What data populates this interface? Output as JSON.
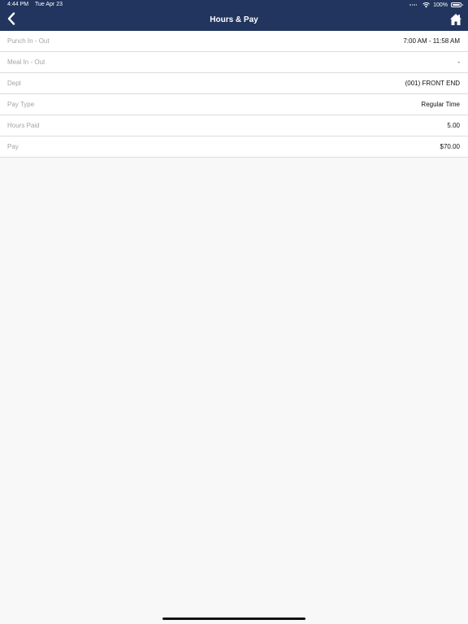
{
  "status_bar": {
    "time": "4:44 PM",
    "date": "Tue Apr 23",
    "battery": "100%"
  },
  "nav": {
    "title": "Hours & Pay",
    "back_icon": "chevron-left-icon",
    "home_icon": "home-icon"
  },
  "rows": [
    {
      "label": "Punch In - Out",
      "value": "7:00 AM - 11:58 AM"
    },
    {
      "label": "Meal In - Out",
      "value": "-"
    },
    {
      "label": "Dept",
      "value": "(001) FRONT END"
    },
    {
      "label": "Pay Type",
      "value": "Regular Time"
    },
    {
      "label": "Hours Paid",
      "value": "5.00"
    },
    {
      "label": "Pay",
      "value": "$70.00"
    }
  ],
  "colors": {
    "nav_background": "#22355f",
    "page_background": "#f8f8f8",
    "label_text": "#a4a4a4",
    "value_text": "#111111"
  }
}
